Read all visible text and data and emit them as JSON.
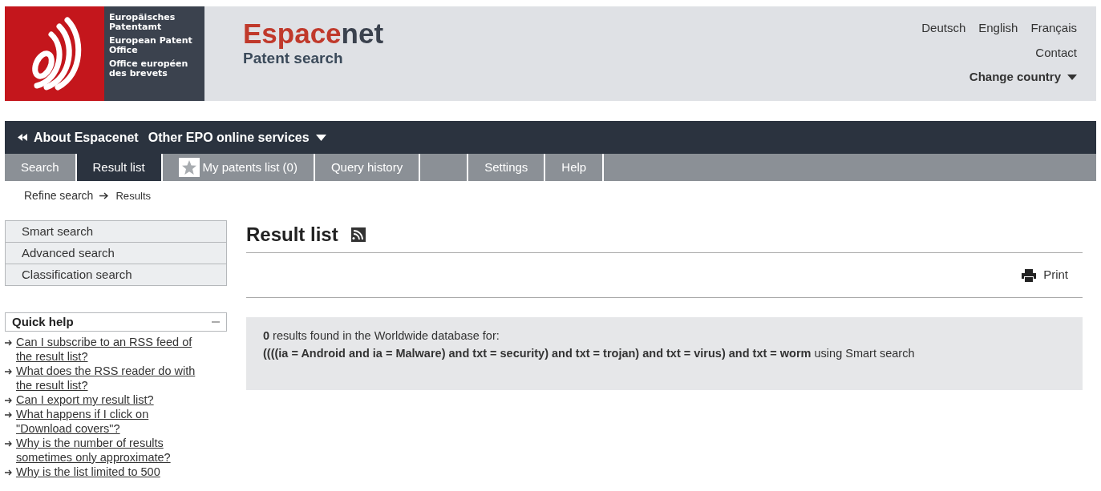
{
  "logo": {
    "lines": [
      "Europäisches Patentamt",
      "European Patent Office",
      "Office européen des brevets"
    ]
  },
  "brand": {
    "highlight": "Espace",
    "rest": "net",
    "subtitle": "Patent search"
  },
  "languages": [
    {
      "label": "Deutsch"
    },
    {
      "label": "English"
    },
    {
      "label": "Français"
    }
  ],
  "contact": "Contact",
  "change_country": "Change country",
  "service_bar": {
    "about": "About Espacenet",
    "other": "Other EPO online services"
  },
  "tabs": [
    {
      "kind": "text",
      "label": "Search",
      "selected": false
    },
    {
      "kind": "text",
      "label": "Result list",
      "selected": true
    },
    {
      "kind": "star",
      "label": "My patents list (0)",
      "selected": false
    },
    {
      "kind": "text",
      "label": "Query history",
      "selected": false
    },
    {
      "kind": "blank",
      "selected": false
    },
    {
      "kind": "text",
      "label": "Settings",
      "selected": false
    },
    {
      "kind": "text",
      "label": "Help",
      "selected": false
    }
  ],
  "breadcrumb": {
    "link": "Refine search",
    "current": "Results"
  },
  "search_menu": [
    {
      "label": "Smart search"
    },
    {
      "label": "Advanced search"
    },
    {
      "label": "Classification search"
    }
  ],
  "quick_help": {
    "title": "Quick help",
    "expanded": true,
    "links": [
      "Can I subscribe to an RSS feed of the result list?",
      "What does the RSS reader do with the result list?",
      "Can I export my result list?",
      "What happens if I click on \"Download covers\"?",
      "Why is the number of results sometimes only approximate?",
      "Why is the list limited to 500"
    ]
  },
  "result": {
    "title": "Result list",
    "print": "Print",
    "summary": "**0** results found in the Worldwide database for:",
    "query": "**((((ia = Android and ia = Malware) and txt = security) and txt = trojan) and txt = virus) and txt = worm** using Smart search"
  }
}
